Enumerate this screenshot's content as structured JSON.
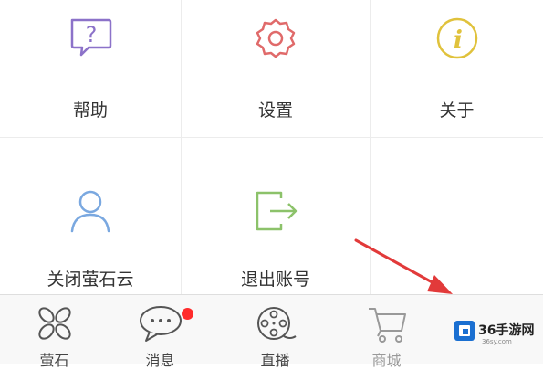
{
  "grid": {
    "items": [
      {
        "label": "帮助",
        "icon": "help-bubble-icon",
        "color": "#8c72c9"
      },
      {
        "label": "设置",
        "icon": "gear-icon",
        "color": "#e06a6a"
      },
      {
        "label": "关于",
        "icon": "info-icon",
        "color": "#e0c23c"
      },
      {
        "label": "关闭萤石云",
        "icon": "user-icon",
        "color": "#7aa8e0"
      },
      {
        "label": "退出账号",
        "icon": "logout-icon",
        "color": "#8cc26a"
      }
    ]
  },
  "tabbar": {
    "tabs": [
      {
        "label": "萤石",
        "icon": "petal-icon"
      },
      {
        "label": "消息",
        "icon": "chat-bubble-icon",
        "badge": true
      },
      {
        "label": "直播",
        "icon": "film-reel-icon"
      },
      {
        "label": "商城",
        "icon": "cart-icon"
      }
    ]
  },
  "watermark": {
    "text": "36手游网",
    "subtext": "36sy.com"
  },
  "colors": {
    "badge": "#ff2b2b",
    "arrow": "#e23a3a"
  }
}
